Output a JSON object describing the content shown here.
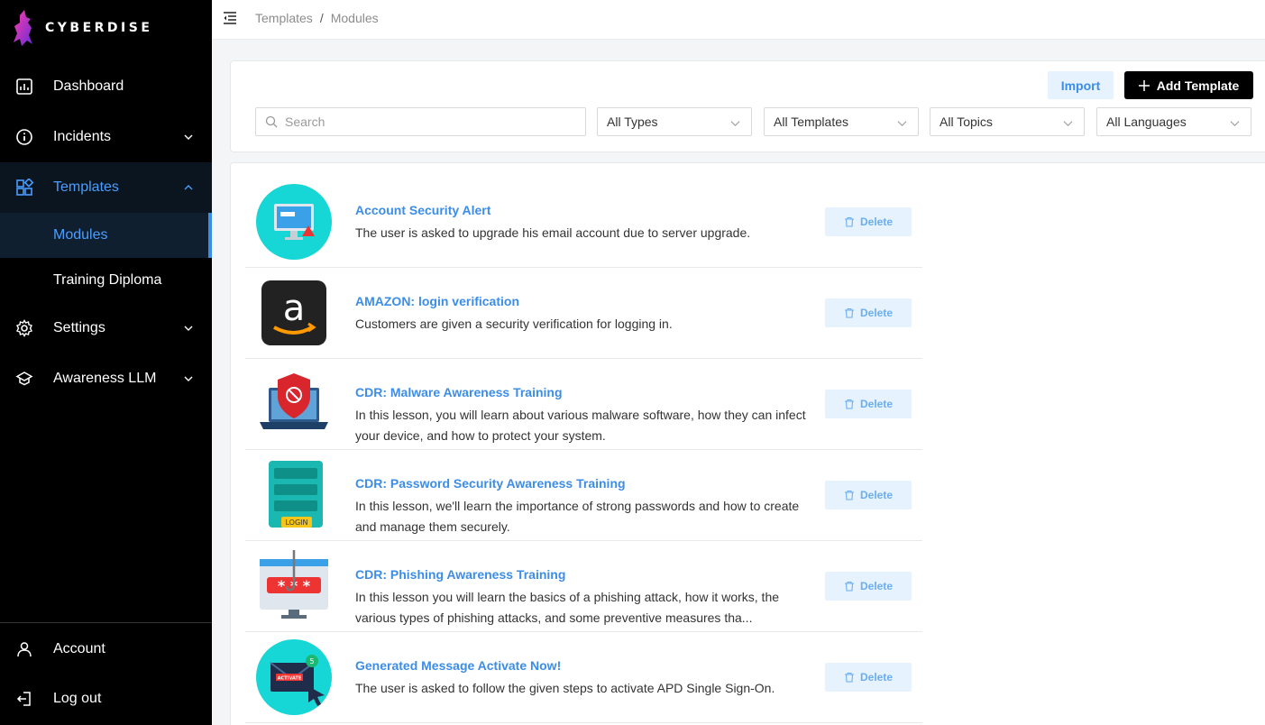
{
  "brand": {
    "name": "CYBERDISE"
  },
  "sidebar": {
    "items": [
      {
        "label": "Dashboard",
        "icon": "dashboard-icon"
      },
      {
        "label": "Incidents",
        "icon": "info-icon"
      },
      {
        "label": "Templates",
        "icon": "templates-icon"
      },
      {
        "label": "Settings",
        "icon": "gear-icon"
      },
      {
        "label": "Awareness LLM",
        "icon": "awareness-icon"
      }
    ],
    "sub_items": [
      {
        "label": "Modules"
      },
      {
        "label": "Training Diploma"
      }
    ],
    "footer": [
      {
        "label": "Account",
        "icon": "user-icon"
      },
      {
        "label": "Log out",
        "icon": "logout-icon"
      }
    ]
  },
  "breadcrumb": {
    "parent": "Templates",
    "separator": "/",
    "current": "Modules"
  },
  "toolbar": {
    "import_label": "Import",
    "add_label": "Add Template"
  },
  "filters": {
    "search_placeholder": "Search",
    "types": "All Types",
    "templates": "All Templates",
    "topics": "All Topics",
    "languages": "All Languages"
  },
  "modules": [
    {
      "title": "Account Security Alert",
      "description": "The user is asked to upgrade his email account due to server upgrade.",
      "delete_label": "Delete"
    },
    {
      "title": "AMAZON: login verification",
      "description": "Customers are given a security verification for logging in.",
      "delete_label": "Delete"
    },
    {
      "title": "CDR: Malware Awareness Training",
      "description": "In this lesson, you will learn about various malware software, how they can infect your device, and how to protect your system.",
      "delete_label": "Delete"
    },
    {
      "title": "CDR: Password Security Awareness Training",
      "description": "In this lesson, we'll learn the importance of strong passwords and how to create and manage them securely.",
      "delete_label": "Delete"
    },
    {
      "title": "CDR: Phishing Awareness Training",
      "description": "In this lesson you will learn the basics of a phishing attack, how it works, the various types of phishing attacks, and some preventive measures tha...",
      "delete_label": "Delete"
    },
    {
      "title": "Generated Message Activate Now!",
      "description": "The user is asked to follow the given steps to activate APD Single Sign-On.",
      "delete_label": "Delete"
    }
  ],
  "thumb_text": {
    "login": "LOGIN",
    "activate": "ACTIVATE",
    "badge": "5"
  },
  "colors": {
    "accent": "#3b8de8",
    "sidebar_bg": "#000000",
    "delete_bg": "#e6f2fd"
  }
}
